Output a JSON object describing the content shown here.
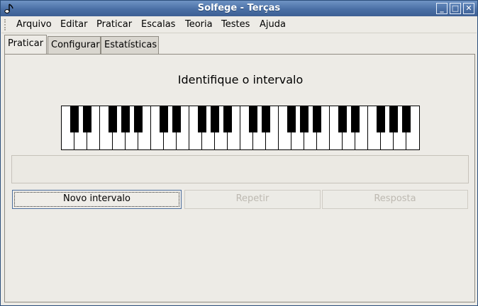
{
  "window": {
    "title": "Solfege - Terças"
  },
  "menu": {
    "items": [
      "Arquivo",
      "Editar",
      "Praticar",
      "Escalas",
      "Teoria",
      "Testes",
      "Ajuda"
    ]
  },
  "tabs": [
    {
      "label": "Praticar",
      "active": true
    },
    {
      "label": "Configurar",
      "active": false
    },
    {
      "label": "Estatísticas",
      "active": false
    }
  ],
  "exercise": {
    "heading": "Identifique o intervalo",
    "answer_text": ""
  },
  "piano": {
    "white_keys": 28,
    "octaves": 4
  },
  "buttons": {
    "new_interval": "Novo intervalo",
    "repeat": "Repetir",
    "answer": "Resposta"
  },
  "colors": {
    "titlebar": "#4a6fa5",
    "background": "#edebe6",
    "focus_border": "#4d6f9e"
  }
}
